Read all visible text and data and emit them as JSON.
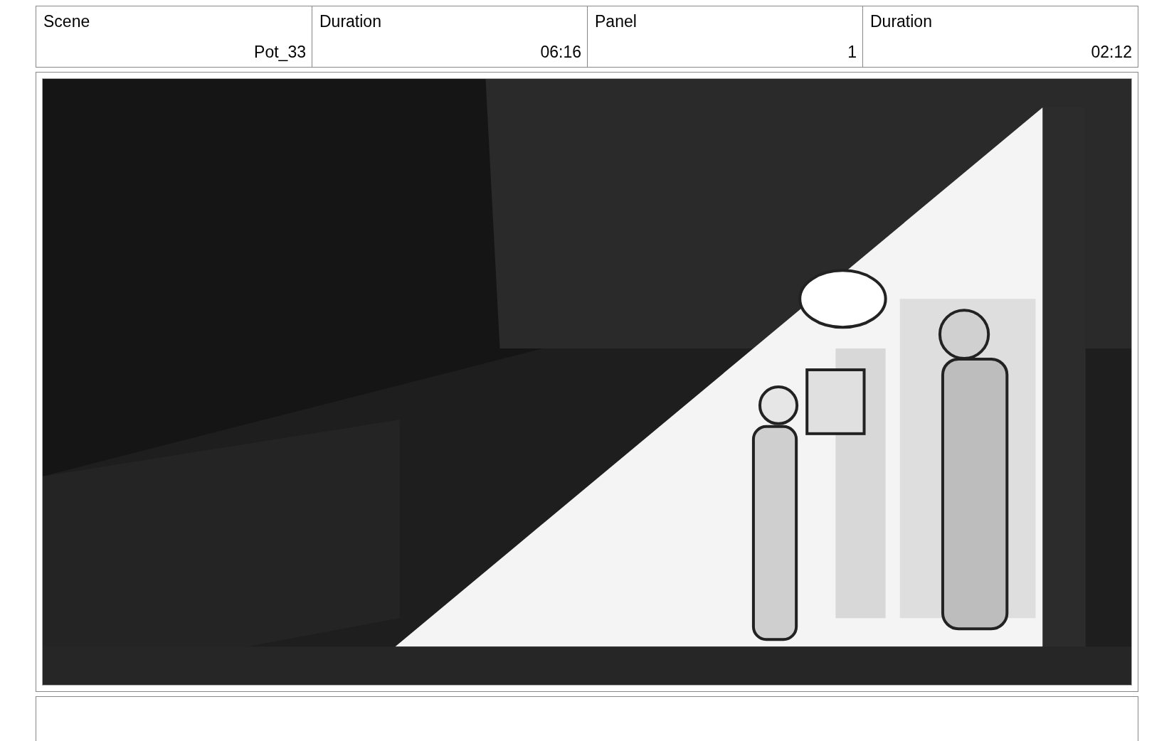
{
  "header": {
    "labels": [
      "Scene",
      "Duration",
      "Panel",
      "Duration"
    ],
    "values": [
      "Pot_33",
      "06:16",
      "1",
      "02:12"
    ]
  }
}
